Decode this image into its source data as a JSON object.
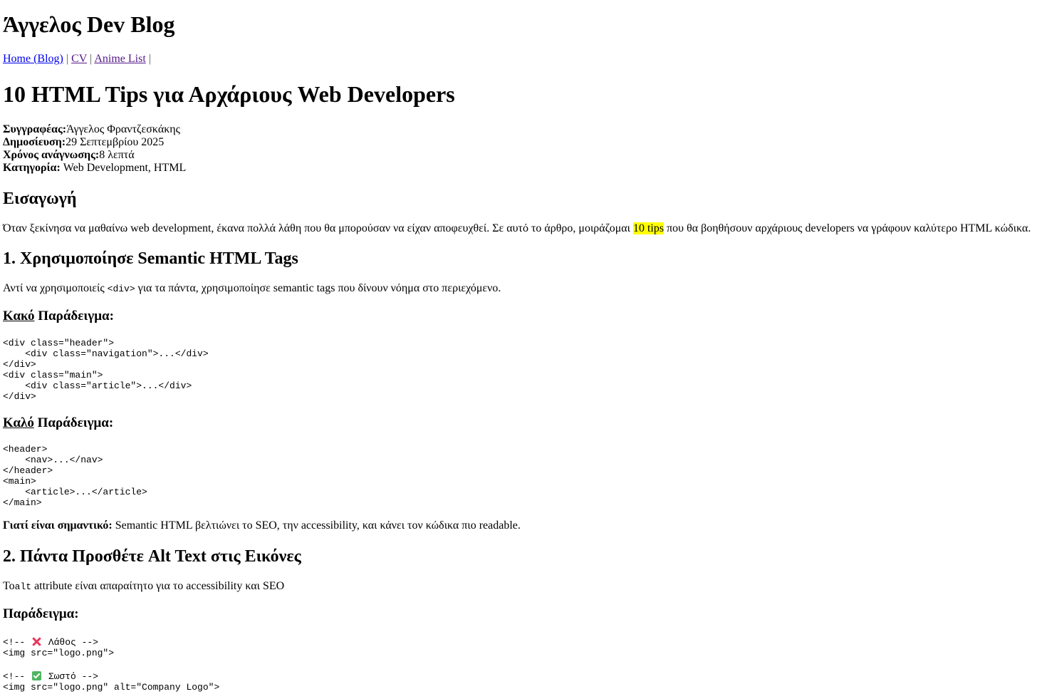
{
  "blog": {
    "title": "Άγγελος Dev Blog"
  },
  "nav": {
    "items": [
      {
        "label": "Home (Blog)"
      },
      {
        "label": "CV"
      },
      {
        "label": "Anime List"
      }
    ],
    "separator": "|"
  },
  "article": {
    "title": "10 HTML Tips για Αρχάριους Web Developers",
    "meta": {
      "author_label": "Συγγραφέας:",
      "author": "Άγγελος Φραντζεσκάκης",
      "published_label": "Δημοσίευση:",
      "published": "29 Σεπτεμβρίου 2025",
      "reading_label": "Χρόνος ανάγνωσης:",
      "reading": "8 λεπτά",
      "category_label": "Κατηγορία:",
      "category": "Web Development, HTML"
    },
    "intro": {
      "heading": "Εισαγωγή",
      "text_before": "Όταν ξεκίνησα να μαθαίνω web development, έκανα πολλά λάθη που θα μπορούσαν να είχαν αποφευχθεί. Σε αυτό το άρθρο, μοιράζομαι ",
      "highlight": "10 tips",
      "text_after": " που θα βοηθήσουν αρχάριους developers να γράφουν καλύτερο HTML κώδικα."
    },
    "tip1": {
      "heading": "1. Χρησιμοποίησε Semantic HTML Tags",
      "text_before": "Αντί να χρησιμοποιείς ",
      "code": "<div>",
      "text_after": " για τα πάντα, χρησιμοποίησε semantic tags που δίνουν νόημα στο περιεχόμενο.",
      "bad_label": "Κακό",
      "bad_suffix": " Παράδειγμα:",
      "bad_code": "<div class=\"header\">\n    <div class=\"navigation\">...</div>\n</div>\n<div class=\"main\">\n    <div class=\"article\">...</div>\n</div>",
      "good_label": "Καλό",
      "good_suffix": " Παράδειγμα:",
      "good_code": "<header>\n    <nav>...</nav>\n</header>\n<main>\n    <article>...</article>\n</main>",
      "why_label": "Γιατί είναι σημαντικό:",
      "why_text": " Semantic HTML βελτιώνει το SEO, την accessibility, και κάνει τον κώδικα πιο readable."
    },
    "tip2": {
      "heading": "2. Πάντα Προσθέτε Alt Text στις Εικόνες",
      "text_before": "Το",
      "code": "alt",
      "text_after": " attribute είναι απαραίτητο για το accessibility και SEO",
      "example_heading": "Παράδειγμα:",
      "wrong_comment_open": "<!-- ",
      "wrong_comment_text": " Λάθος -->",
      "wrong_code": "<img src=\"logo.png\">",
      "right_comment_open": "<!-- ",
      "right_comment_text": " Σωστό -->",
      "right_code": "<img src=\"logo.png\" alt=\"Company Logo\">",
      "wrong_icon": "cross-mark-icon",
      "right_icon": "check-mark-icon"
    }
  },
  "colors": {
    "link": "#0000ee",
    "visited": "#551a8b",
    "highlight": "#ffff00",
    "cross": "#e8365d",
    "check": "#4fb560"
  }
}
